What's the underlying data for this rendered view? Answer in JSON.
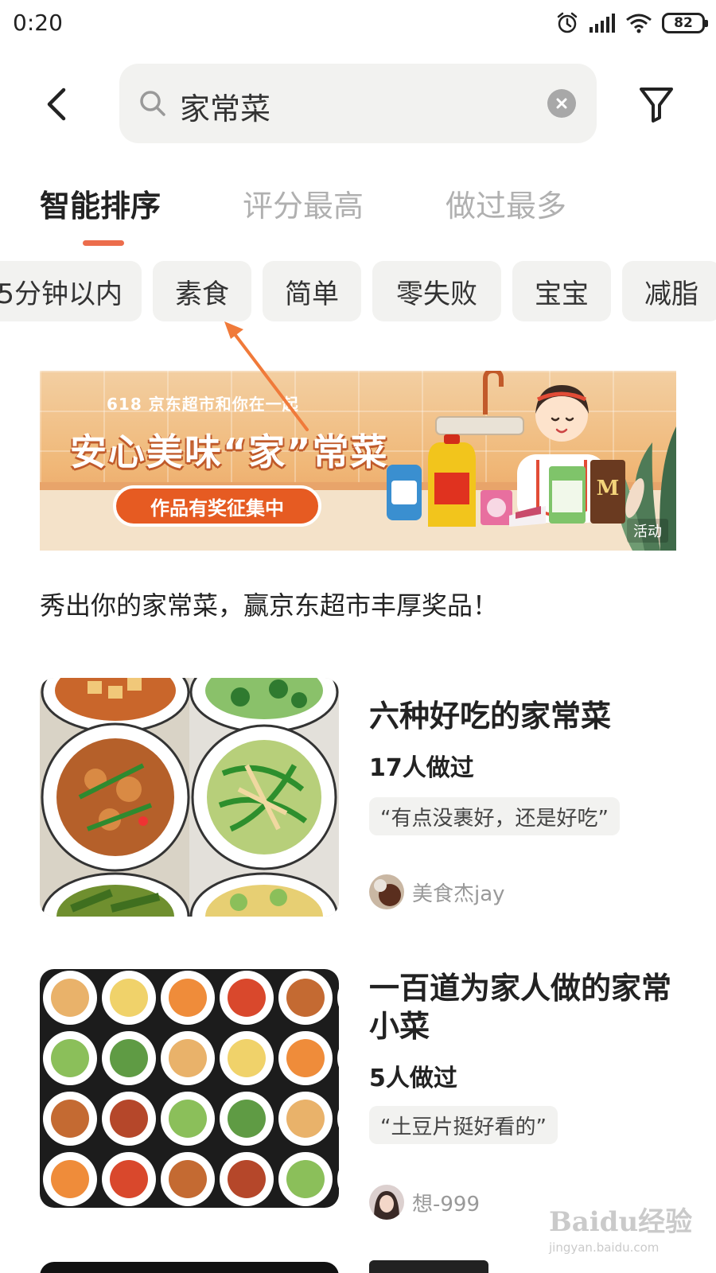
{
  "status_bar": {
    "time": "0:20",
    "battery": "82"
  },
  "search": {
    "query": "家常菜"
  },
  "sort_tabs": [
    {
      "label": "智能排序",
      "active": true
    },
    {
      "label": "评分最高",
      "active": false
    },
    {
      "label": "做过最多",
      "active": false
    }
  ],
  "chips": [
    "5分钟以内",
    "素食",
    "简单",
    "零失败",
    "宝宝",
    "减脂"
  ],
  "banner": {
    "subtitle": "618 京东超市和你在一起",
    "title": "安心美味“家”常菜",
    "cta": "作品有奖征集中",
    "tag": "活动"
  },
  "promo_text": "秀出你的家常菜，赢京东超市丰厚奖品！",
  "recipes": [
    {
      "title": "六种好吃的家常菜",
      "count": "17人做过",
      "quote": "“有点没裹好，还是好吃”",
      "author": "美食杰jay"
    },
    {
      "title": "一百道为家人做的家常小菜",
      "count": "5人做过",
      "quote": "“土豆片挺好看的”",
      "author": "想-999"
    }
  ],
  "watermark": {
    "logo": "Baidu经验",
    "url": "jingyan.baidu.com"
  },
  "colors": {
    "accent": "#ec6d4c",
    "chip_bg": "#f2f2f0",
    "muted": "#b0b0b0"
  }
}
